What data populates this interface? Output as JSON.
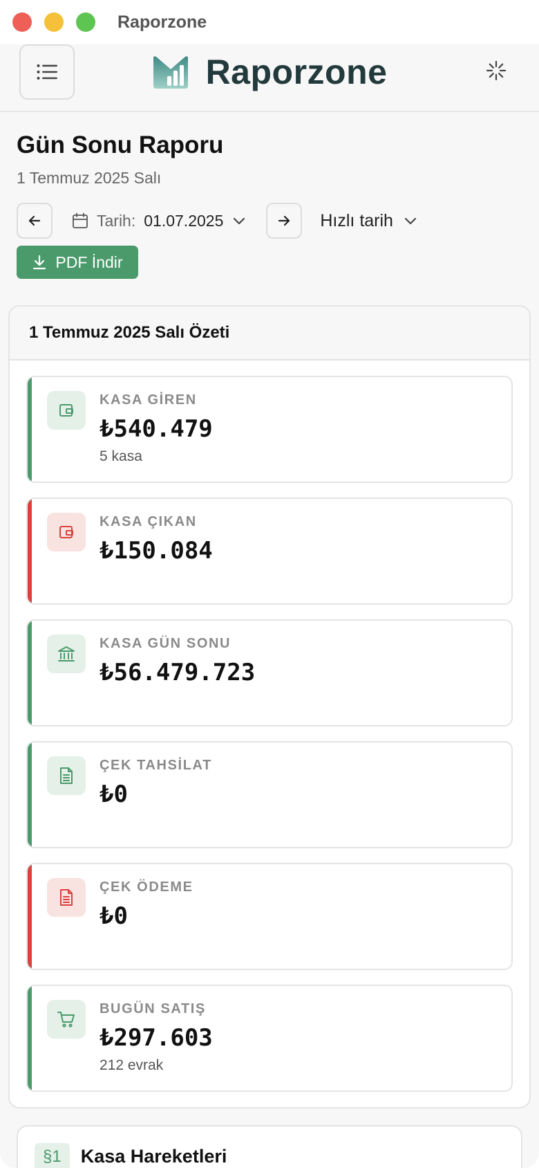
{
  "window": {
    "title": "Raporzone"
  },
  "header": {
    "brand": "Raporzone"
  },
  "page": {
    "title": "Gün Sonu Raporu",
    "subtitle": "1 Temmuz 2025 Salı",
    "date_label": "Tarih:",
    "date_value": "01.07.2025",
    "quick_date": "Hızlı tarih",
    "pdf_label": "PDF İndir"
  },
  "summary": {
    "title": "1 Temmuz 2025 Salı Özeti",
    "stats": [
      {
        "label": "KASA GİREN",
        "value": "₺540.479",
        "sub": "5 kasa",
        "tone": "green",
        "icon": "wallet-icon"
      },
      {
        "label": "KASA ÇIKAN",
        "value": "₺150.084",
        "sub": "",
        "tone": "red",
        "icon": "wallet-icon"
      },
      {
        "label": "KASA GÜN SONU",
        "value": "₺56.479.723",
        "sub": "",
        "tone": "green",
        "icon": "bank-icon"
      },
      {
        "label": "ÇEK TAHSİLAT",
        "value": "₺0",
        "sub": "",
        "tone": "green",
        "icon": "document-icon"
      },
      {
        "label": "ÇEK ÖDEME",
        "value": "₺0",
        "sub": "",
        "tone": "red",
        "icon": "document-icon"
      },
      {
        "label": "BUGÜN SATIŞ",
        "value": "₺297.603",
        "sub": "212 evrak",
        "tone": "green",
        "icon": "cart-icon"
      }
    ]
  },
  "section1": {
    "badge": "§1",
    "title": "Kasa Hareketleri"
  },
  "colors": {
    "accent_green": "#4a9a6b",
    "accent_red": "#d9423c",
    "brand_dark": "#233a3d"
  }
}
